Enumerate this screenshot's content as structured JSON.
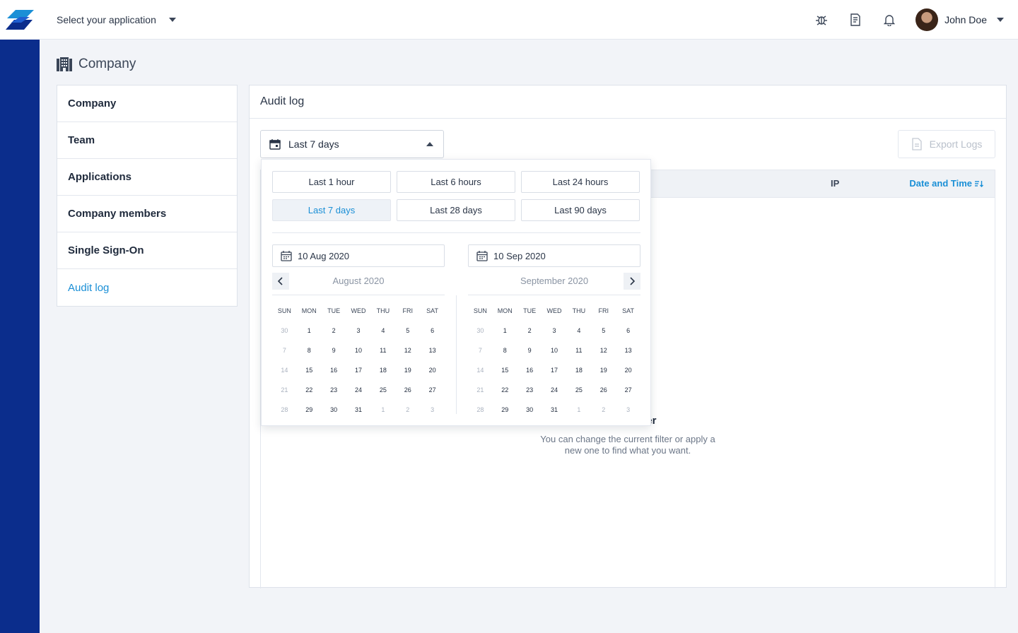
{
  "topbar": {
    "app_select_label": "Select your application",
    "user_name": "John Doe"
  },
  "icons": {
    "logo": "brand-logo",
    "bug": "bug-icon",
    "docs": "document-icon",
    "bell": "bell-icon"
  },
  "colors": {
    "accent": "#1a8fd6",
    "rail": "#0b2d8c"
  },
  "page": {
    "title": "Company"
  },
  "sidebar": {
    "items": [
      {
        "label": "Company"
      },
      {
        "label": "Team"
      },
      {
        "label": "Applications"
      },
      {
        "label": "Company members"
      },
      {
        "label": "Single Sign-On"
      },
      {
        "label": "Audit log"
      }
    ]
  },
  "panel": {
    "title": "Audit log",
    "range_value": "Last 7 days",
    "export_label": "Export Logs",
    "columns": {
      "ip": "IP",
      "date": "Date and Time"
    },
    "empty": {
      "title": "hosen filter",
      "desc": "You can change the current filter or apply a new one to find what you want."
    }
  },
  "picker": {
    "presets": [
      "Last 1 hour",
      "Last 6 hours",
      "Last 24 hours",
      "Last 7 days",
      "Last 28 days",
      "Last 90 days"
    ],
    "active_preset": "Last 7 days",
    "start_date": "10 Aug 2020",
    "end_date": "10 Sep 2020",
    "months": [
      {
        "name": "August 2020",
        "dow": [
          "SUN",
          "MON",
          "TUE",
          "WED",
          "THU",
          "FRI",
          "SAT"
        ],
        "weeks": [
          [
            "30",
            "1",
            "2",
            "3",
            "4",
            "5",
            "6"
          ],
          [
            "7",
            "8",
            "9",
            "10",
            "11",
            "12",
            "13"
          ],
          [
            "14",
            "15",
            "16",
            "17",
            "18",
            "19",
            "20"
          ],
          [
            "21",
            "22",
            "23",
            "24",
            "25",
            "26",
            "27"
          ],
          [
            "28",
            "29",
            "30",
            "31",
            "1",
            "2",
            "3"
          ]
        ],
        "muted": [
          [
            0
          ],
          [
            0
          ],
          [
            0
          ],
          [
            0
          ],
          [
            0,
            4,
            5,
            6
          ]
        ]
      },
      {
        "name": "September 2020",
        "dow": [
          "SUN",
          "MON",
          "TUE",
          "WED",
          "THU",
          "FRI",
          "SAT"
        ],
        "weeks": [
          [
            "30",
            "1",
            "2",
            "3",
            "4",
            "5",
            "6"
          ],
          [
            "7",
            "8",
            "9",
            "10",
            "11",
            "12",
            "13"
          ],
          [
            "14",
            "15",
            "16",
            "17",
            "18",
            "19",
            "20"
          ],
          [
            "21",
            "22",
            "23",
            "24",
            "25",
            "26",
            "27"
          ],
          [
            "28",
            "29",
            "30",
            "31",
            "1",
            "2",
            "3"
          ]
        ],
        "muted": [
          [
            0
          ],
          [
            0
          ],
          [
            0
          ],
          [
            0
          ],
          [
            0,
            4,
            5,
            6
          ]
        ]
      }
    ]
  }
}
